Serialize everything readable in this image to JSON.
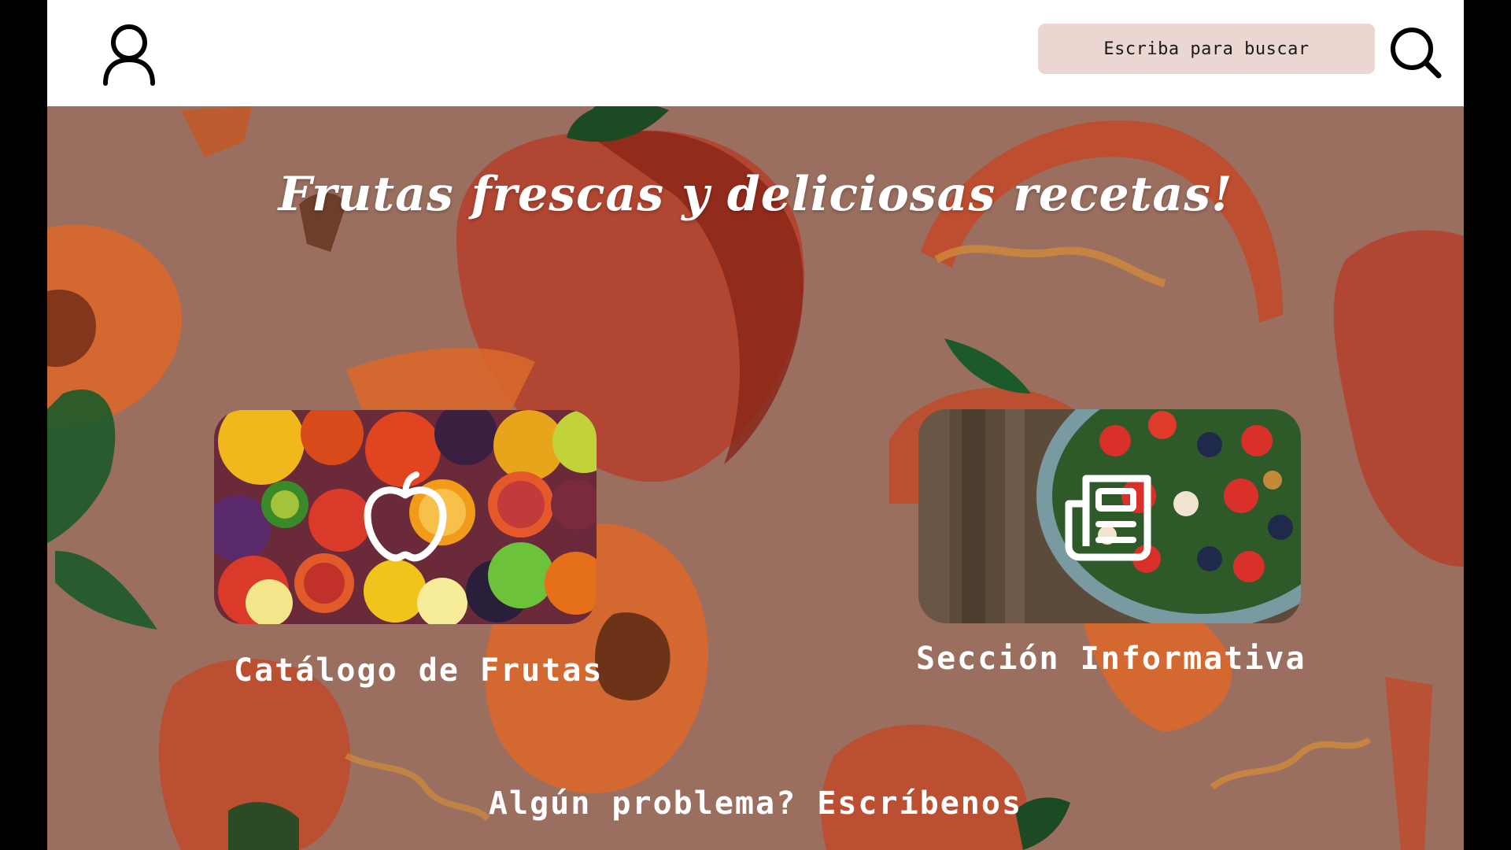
{
  "header": {
    "search_placeholder": "Escriba para buscar",
    "user_icon": "user-icon",
    "search_icon": "search-icon"
  },
  "hero": {
    "title": "Frutas frescas y deliciosas recetas!"
  },
  "cards": [
    {
      "label": "Catálogo de Frutas",
      "icon": "apple-icon"
    },
    {
      "label": "Sección Informativa",
      "icon": "newspaper-icon"
    }
  ],
  "footer": {
    "contact_text": "Algún problema? Escríbenos"
  },
  "colors": {
    "background": "#9a6f60",
    "search_bg": "#ecd6d2",
    "header_bg": "#ffffff",
    "text_on_bg": "#ffffff"
  }
}
